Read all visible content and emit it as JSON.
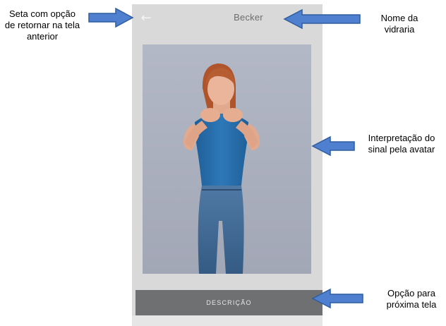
{
  "app": {
    "title": "Becker",
    "back_glyph": "←",
    "button_label": "DESCRIÇÃO"
  },
  "annotations": {
    "back_line1": "Seta com opção",
    "back_line2": "de retornar na tela",
    "back_line3": "anterior",
    "name_line1": "Nome da",
    "name_line2": "vidraria",
    "avatar_line1": "Interpretação do",
    "avatar_line2": "sinal pela avatar",
    "next_line1": "Opção para",
    "next_line2": "próxima tela"
  },
  "colors": {
    "arrow_fill": "#4f7fcf",
    "arrow_stroke": "#2f5d9f"
  }
}
